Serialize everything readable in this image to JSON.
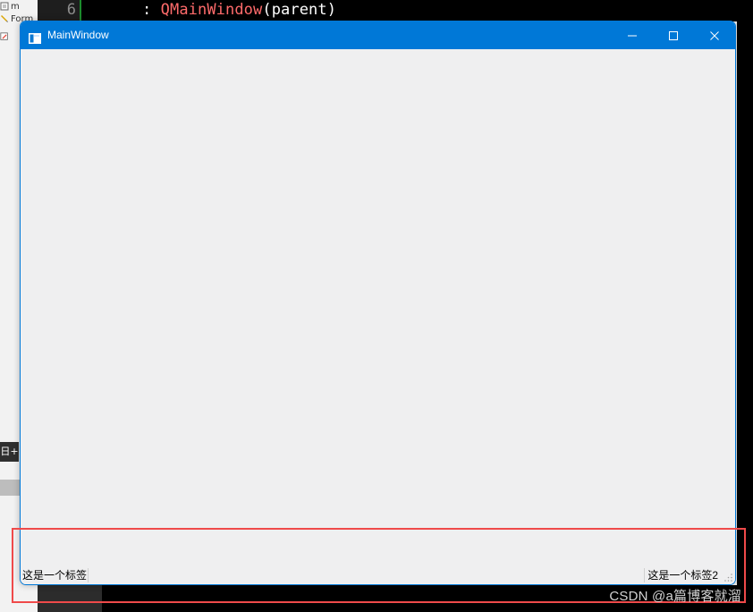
{
  "background_ide": {
    "file_tree": [
      {
        "label": "m",
        "icon": "file-icon"
      },
      {
        "label": "Form",
        "icon": "form-icon"
      },
      {
        "label": "",
        "icon": "edit-form-icon"
      }
    ],
    "line_number": "6",
    "code": {
      "colon": ": ",
      "class_name": "QMainWindow",
      "paren_open": "(",
      "parameter": "parent",
      "paren_close": ")"
    },
    "dark_tab_text": "日+"
  },
  "main_window": {
    "title": "MainWindow",
    "title_icon": "window-app-icon",
    "controls": [
      {
        "name": "minimize-button",
        "icon": "minimize-icon"
      },
      {
        "name": "maximize-button",
        "icon": "maximize-icon"
      },
      {
        "name": "close-button",
        "icon": "close-icon"
      }
    ],
    "status_bar": {
      "left_label": "这是一个标签",
      "right_label": "这是一个标签2"
    }
  },
  "annotation": {
    "highlight_color": "#ef4a4a"
  },
  "watermark": "CSDN @a篇博客就溜",
  "colors": {
    "window_accent": "#0078d7",
    "window_background": "#efeff0",
    "code_class": "#ff6b6b",
    "line_marker": "#1c8c2d"
  }
}
